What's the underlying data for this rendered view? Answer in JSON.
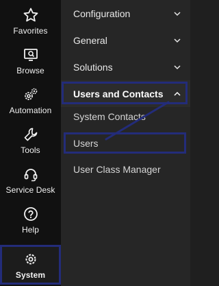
{
  "rail": {
    "items": [
      {
        "label": "Favorites",
        "icon": "star-icon"
      },
      {
        "label": "Browse",
        "icon": "browse-icon"
      },
      {
        "label": "Automation",
        "icon": "gears-icon"
      },
      {
        "label": "Tools",
        "icon": "wrench-icon"
      },
      {
        "label": "Service Desk",
        "icon": "headset-icon"
      },
      {
        "label": "Help",
        "icon": "help-icon"
      },
      {
        "label": "System",
        "icon": "gear-icon",
        "active": true
      }
    ]
  },
  "menu": {
    "items": [
      {
        "label": "Configuration",
        "chevron": "down"
      },
      {
        "label": "General",
        "chevron": "down"
      },
      {
        "label": "Solutions",
        "chevron": "down"
      },
      {
        "label": "Users and Contacts",
        "chevron": "up",
        "expanded": true
      },
      {
        "label": "System Contacts"
      },
      {
        "label": "Users",
        "highlighted": true
      },
      {
        "label": "User Class Manager"
      }
    ]
  },
  "colors": {
    "rail_bg": "#111111",
    "menu_bg": "#262626",
    "highlight_border": "#232c7a",
    "text": "#e9e9e9"
  }
}
